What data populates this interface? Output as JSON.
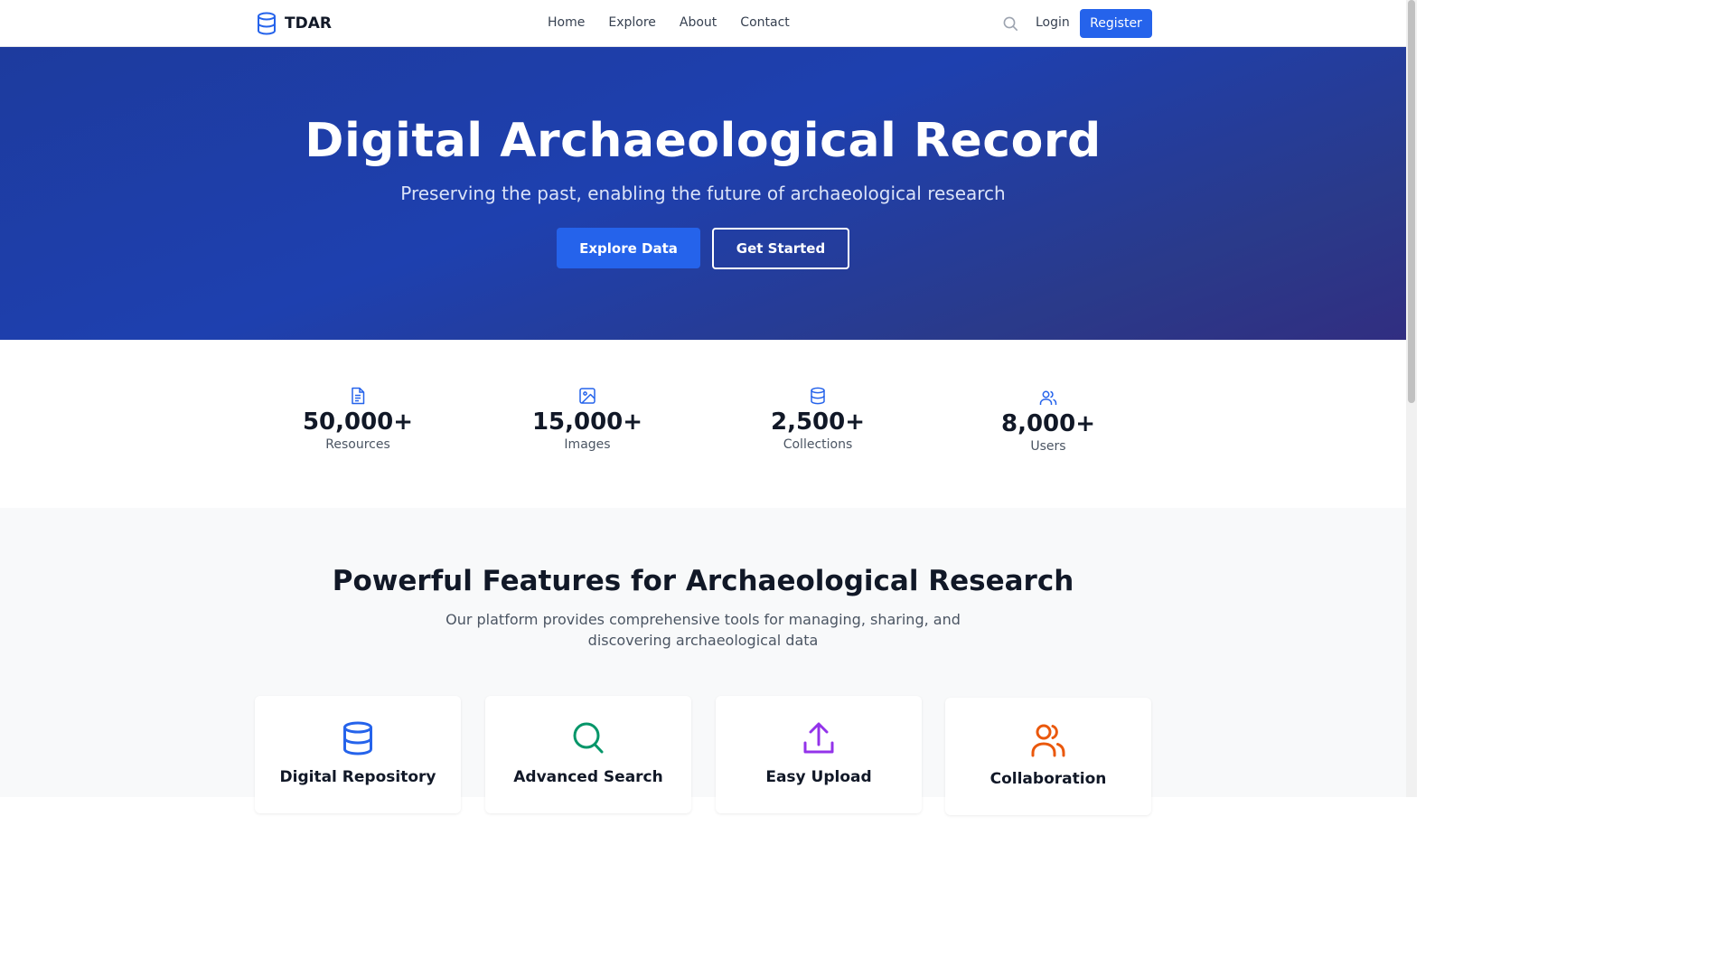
{
  "nav": {
    "logo_text": "TDAR",
    "links": [
      "Home",
      "Explore",
      "About",
      "Contact"
    ],
    "login": "Login",
    "register": "Register",
    "icons": {
      "logo": "database-icon",
      "search": "search-icon"
    }
  },
  "hero": {
    "title": "Digital Archaeological Record",
    "subtitle": "Preserving the past, enabling the future of archaeological research",
    "primary_button": "Explore Data",
    "secondary_button": "Get Started"
  },
  "stats": [
    {
      "value": "50,000+",
      "label": "Resources",
      "icon": "document-icon"
    },
    {
      "value": "15,000+",
      "label": "Images",
      "icon": "image-icon"
    },
    {
      "value": "2,500+",
      "label": "Collections",
      "icon": "database-icon"
    },
    {
      "value": "8,000+",
      "label": "Users",
      "icon": "users-icon"
    }
  ],
  "features": {
    "title": "Powerful Features for Archaeological Research",
    "description": "Our platform provides comprehensive tools for managing, sharing, and discovering archaeological data",
    "cards": [
      {
        "title": "Digital Repository",
        "icon": "database-icon",
        "color": "#2563eb"
      },
      {
        "title": "Advanced Search",
        "icon": "search-icon",
        "color": "#059669"
      },
      {
        "title": "Easy Upload",
        "icon": "upload-icon",
        "color": "#9333ea"
      },
      {
        "title": "Collaboration",
        "icon": "users-icon",
        "color": "#ea580c"
      }
    ]
  },
  "colors": {
    "primary": "#2563eb",
    "hero_gradient_start": "#1d3b9e",
    "hero_gradient_end": "#312e81"
  }
}
